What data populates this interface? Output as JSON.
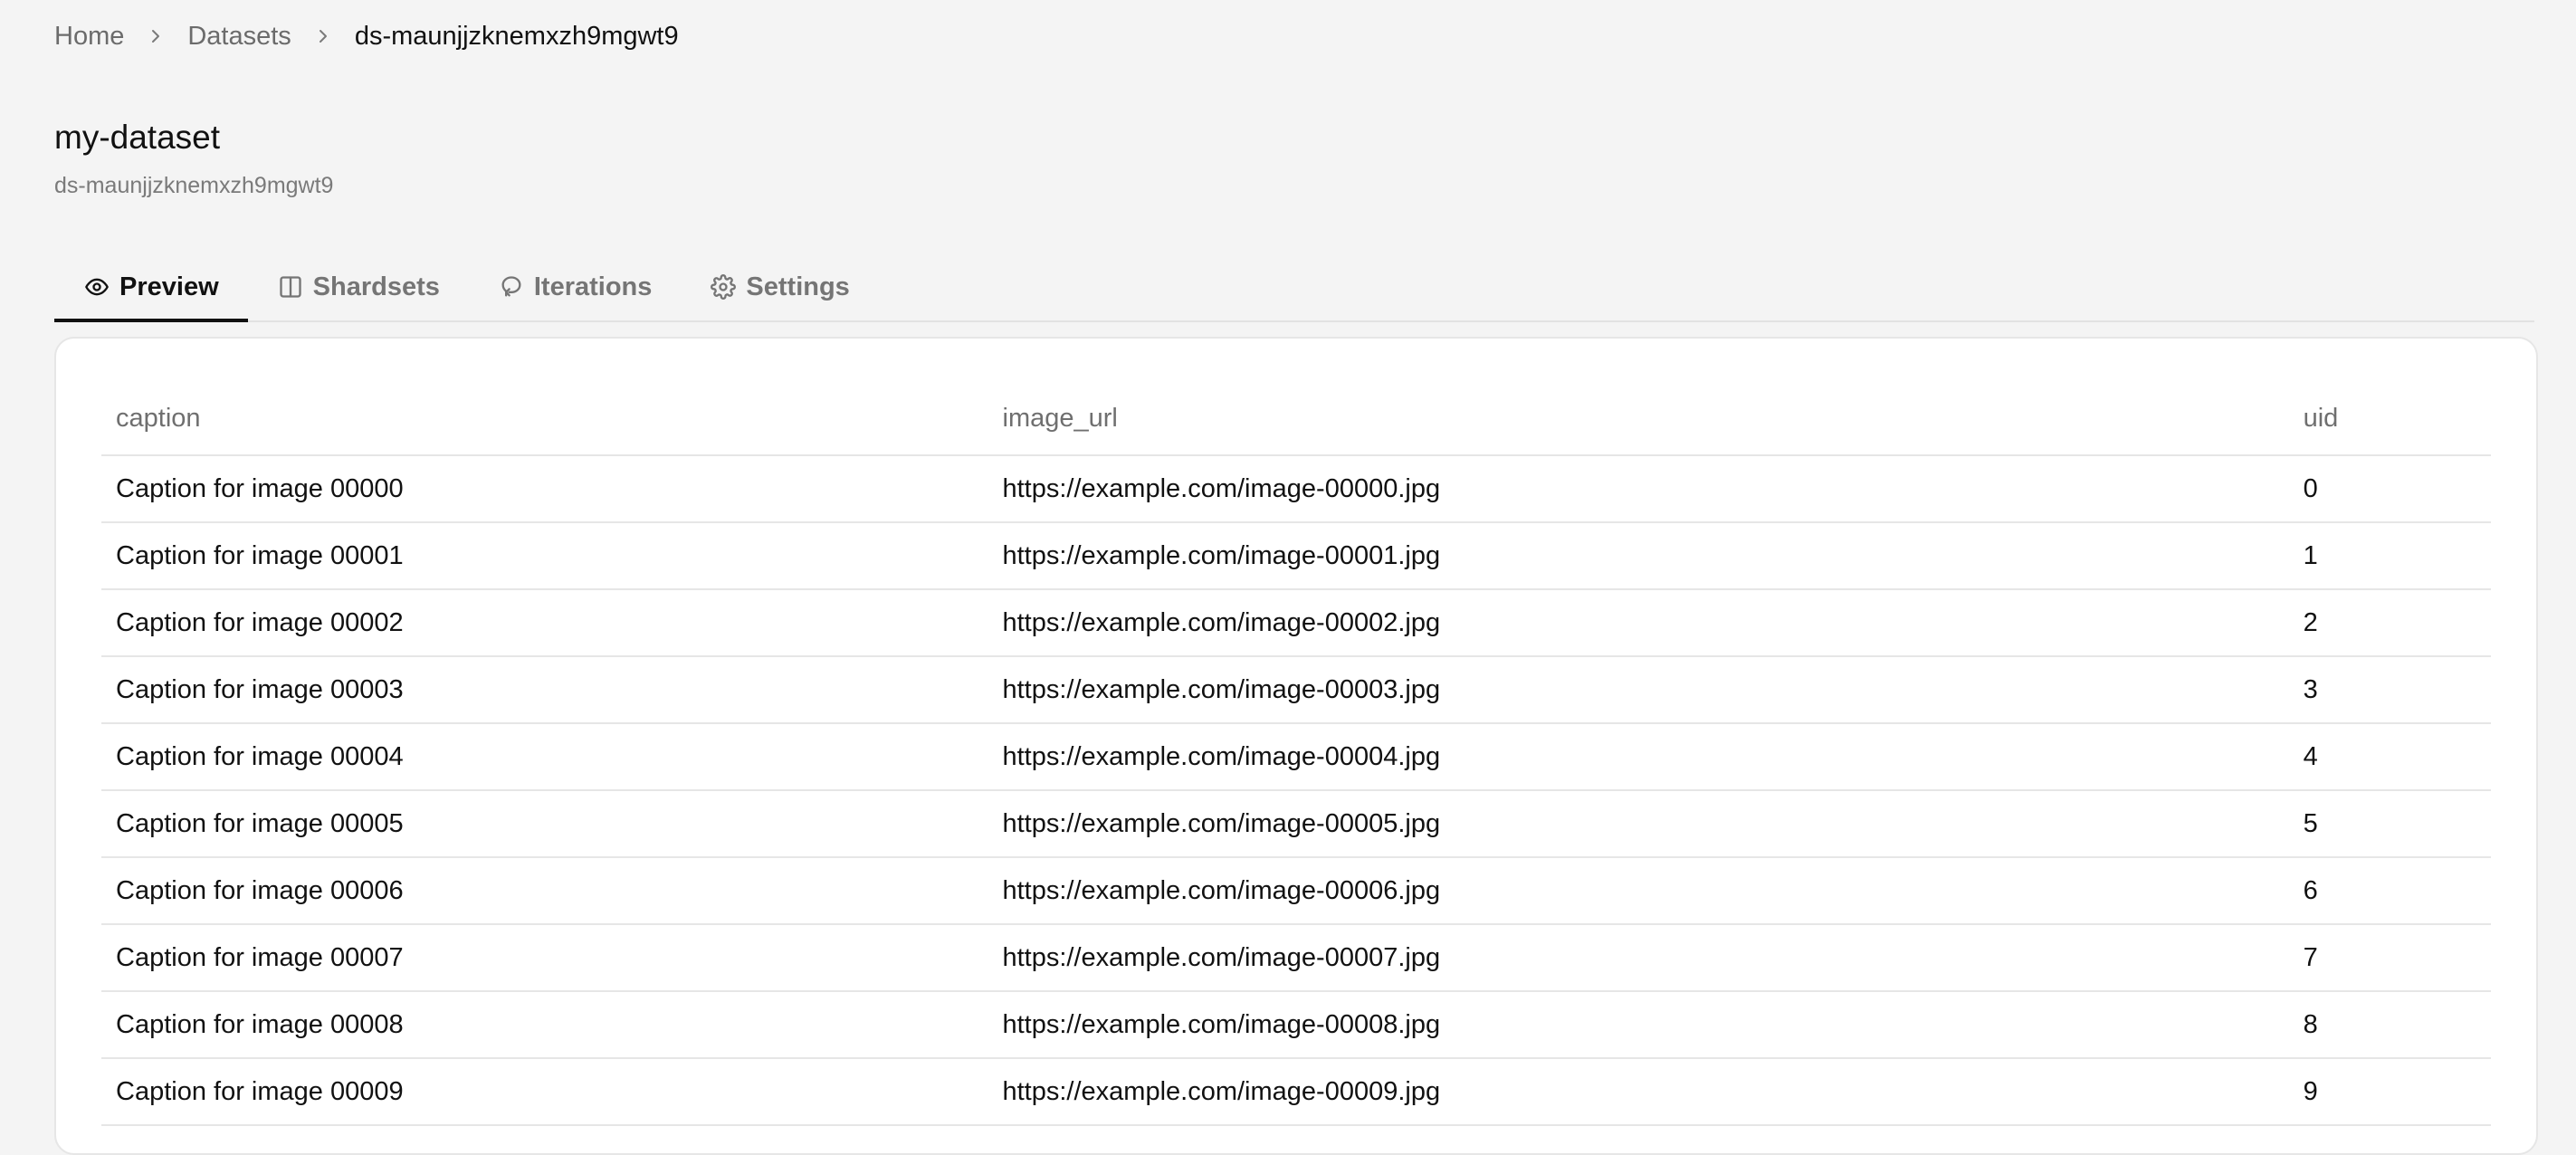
{
  "breadcrumb": {
    "home": "Home",
    "datasets": "Datasets",
    "current": "ds-maunjjzknemxzh9mgwt9"
  },
  "header": {
    "title": "my-dataset",
    "subtitle": "ds-maunjjzknemxzh9mgwt9"
  },
  "tabs": [
    {
      "label": "Preview",
      "icon": "eye-icon",
      "active": true
    },
    {
      "label": "Shardsets",
      "icon": "columns-icon",
      "active": false
    },
    {
      "label": "Iterations",
      "icon": "iterations-icon",
      "active": false
    },
    {
      "label": "Settings",
      "icon": "gear-icon",
      "active": false
    }
  ],
  "table": {
    "columns": [
      "caption",
      "image_url",
      "uid"
    ],
    "rows": [
      [
        "Caption for image 00000",
        "https://example.com/image-00000.jpg",
        "0"
      ],
      [
        "Caption for image 00001",
        "https://example.com/image-00001.jpg",
        "1"
      ],
      [
        "Caption for image 00002",
        "https://example.com/image-00002.jpg",
        "2"
      ],
      [
        "Caption for image 00003",
        "https://example.com/image-00003.jpg",
        "3"
      ],
      [
        "Caption for image 00004",
        "https://example.com/image-00004.jpg",
        "4"
      ],
      [
        "Caption for image 00005",
        "https://example.com/image-00005.jpg",
        "5"
      ],
      [
        "Caption for image 00006",
        "https://example.com/image-00006.jpg",
        "6"
      ],
      [
        "Caption for image 00007",
        "https://example.com/image-00007.jpg",
        "7"
      ],
      [
        "Caption for image 00008",
        "https://example.com/image-00008.jpg",
        "8"
      ],
      [
        "Caption for image 00009",
        "https://example.com/image-00009.jpg",
        "9"
      ]
    ]
  }
}
